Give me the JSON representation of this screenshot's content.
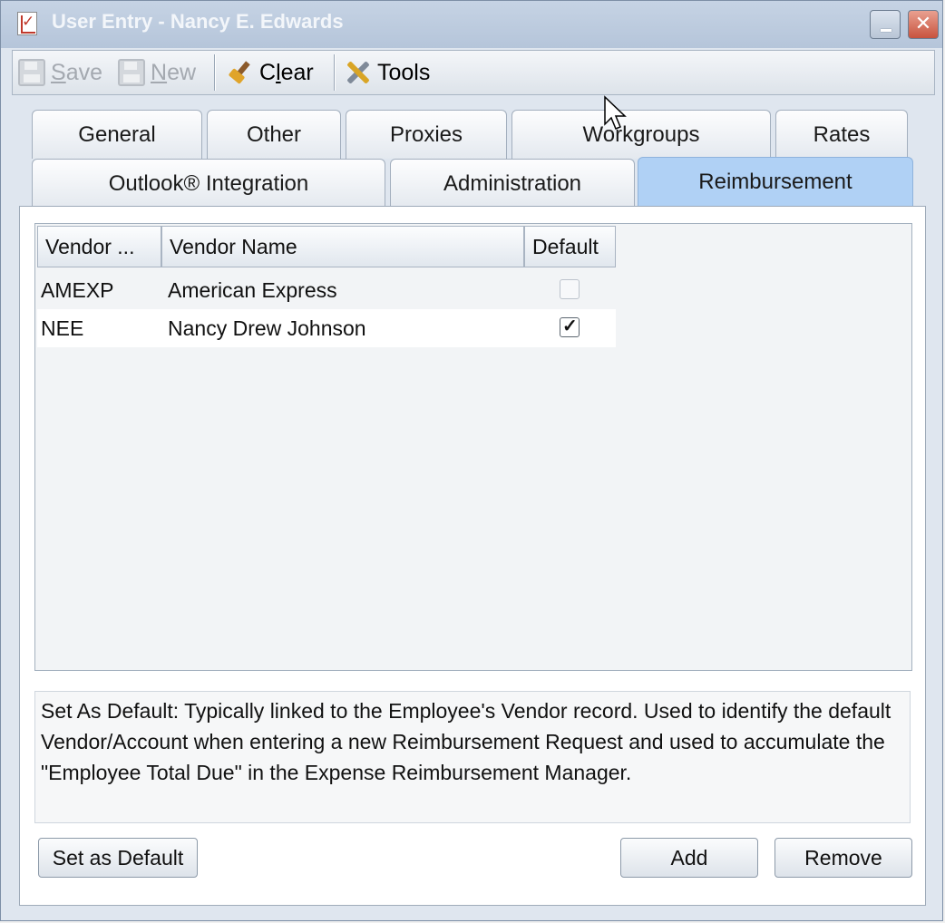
{
  "window": {
    "title": "User Entry - Nancy E. Edwards",
    "close_glyph": "✕"
  },
  "toolbar": {
    "save_prefix": "S",
    "save_rest": "ave",
    "new_prefix": "N",
    "new_rest": "ew",
    "clear_prefix": "C",
    "clear_underlined": "l",
    "clear_rest": "ear",
    "tools_label": "Tools"
  },
  "tabs": {
    "row1": [
      "General",
      "Other",
      "Proxies",
      "Workgroups",
      "Rates"
    ],
    "row2": [
      "Outlook® Integration",
      "Administration",
      "Reimbursement"
    ],
    "active": "Reimbursement"
  },
  "grid": {
    "columns": [
      "Vendor ...",
      "Vendor Name",
      "Default"
    ],
    "rows": [
      {
        "code": "AMEXP",
        "name": "American Express",
        "default": false
      },
      {
        "code": "NEE",
        "name": "Nancy Drew Johnson",
        "default": true
      }
    ],
    "check_glyph": "✓"
  },
  "description": "Set As Default: Typically linked to the Employee's Vendor record.  Used to identify the default Vendor/Account when entering a new Reimbursement Request and used to accumulate the \"Employee Total Due\" in the Expense Reimbursement Manager.",
  "buttons": {
    "set_default": "Set as Default",
    "add": "Add",
    "remove": "Remove"
  },
  "colors": {
    "active_tab": "#b0d1f5",
    "titlebar": "#b5c5da",
    "close_button": "#c8533e"
  }
}
